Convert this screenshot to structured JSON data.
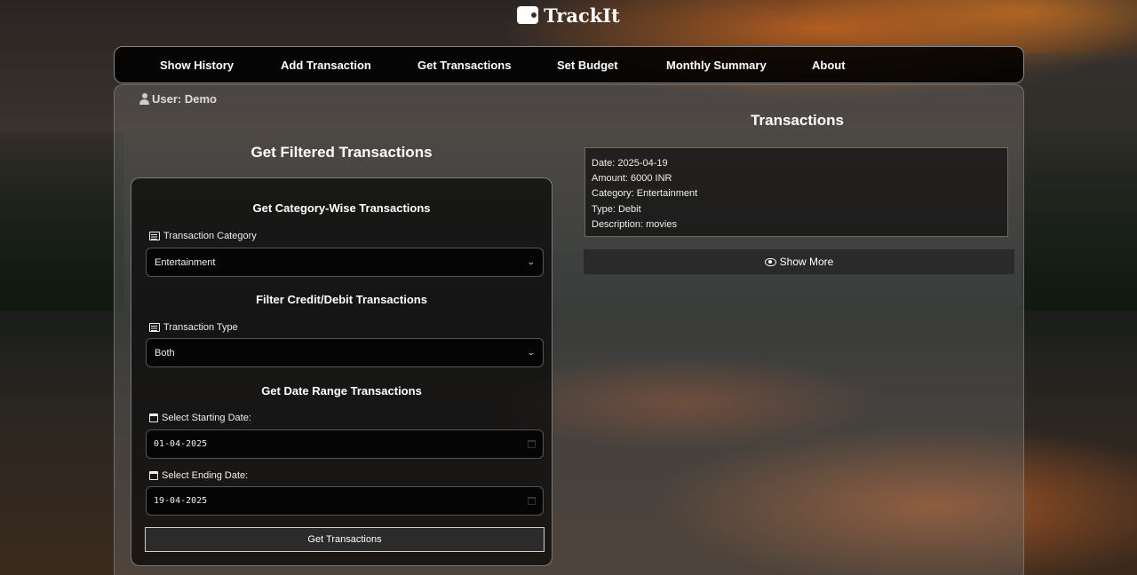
{
  "app": {
    "title": "TrackIt",
    "logo_icon": "wallet-icon"
  },
  "nav": {
    "items": [
      {
        "label": "Show History"
      },
      {
        "label": "Add Transaction"
      },
      {
        "label": "Get Transactions"
      },
      {
        "label": "Set Budget"
      },
      {
        "label": "Monthly Summary"
      },
      {
        "label": "About"
      }
    ]
  },
  "user": {
    "label": "User: Demo",
    "icon": "user-icon"
  },
  "filter_panel": {
    "title": "Get Filtered Transactions",
    "category_section": {
      "title": "Get Category-Wise Transactions",
      "label": "Transaction Category",
      "selected": "Entertainment"
    },
    "type_section": {
      "title": "Filter Credit/Debit Transactions",
      "label": "Transaction Type",
      "selected": "Both"
    },
    "date_section": {
      "title": "Get Date Range Transactions",
      "start_label": "Select Starting Date:",
      "start_value": "01-04-2025",
      "end_label": "Select Ending Date:",
      "end_value": "19-04-2025"
    },
    "submit_label": "Get Transactions"
  },
  "transactions_panel": {
    "title": "Transactions",
    "items": [
      {
        "date": "Date: 2025-04-19",
        "amount": "Amount: 6000 INR",
        "category": "Category: Entertainment",
        "type": "Type: Debit",
        "description": "Description: movies"
      }
    ],
    "show_more_label": "Show More"
  }
}
